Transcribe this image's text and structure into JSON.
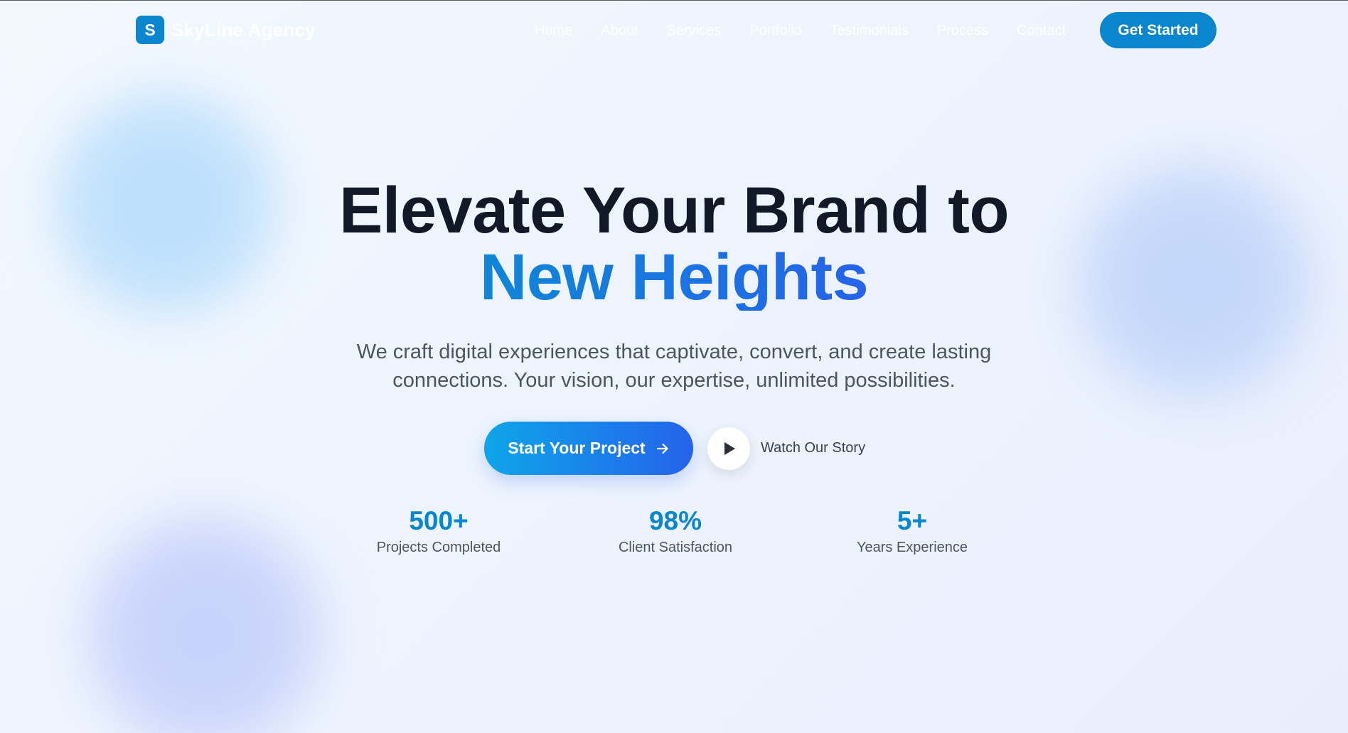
{
  "header": {
    "logo_letter": "S",
    "logo_text": "SkyLine Agency",
    "nav": [
      "Home",
      "About",
      "Services",
      "Portfolio",
      "Testimonials",
      "Process",
      "Contact"
    ],
    "cta_label": "Get Started"
  },
  "hero": {
    "title_line1": "Elevate Your Brand to",
    "title_line2": "New Heights",
    "subtitle_line1": "We craft digital experiences that captivate, convert, and create lasting",
    "subtitle_line2": "connections. Your vision, our expertise, unlimited possibilities.",
    "primary_cta": "Start Your Project",
    "secondary_cta": "Watch Our Story"
  },
  "stats": [
    {
      "value": "500+",
      "label": "Projects Completed"
    },
    {
      "value": "98%",
      "label": "Client Satisfaction"
    },
    {
      "value": "5+",
      "label": "Years Experience"
    }
  ],
  "colors": {
    "brand": "#0a86cf",
    "gradient_start": "#0ea5e9",
    "gradient_end": "#2563eb",
    "heading": "#111827",
    "body_text": "#4b5563"
  },
  "icons": {
    "primary_cta_icon": "arrow-right-icon",
    "secondary_cta_icon": "play-icon"
  }
}
